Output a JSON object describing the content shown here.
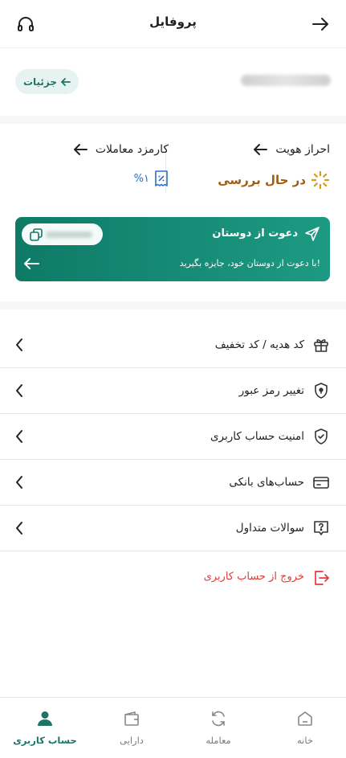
{
  "header": {
    "title": "پروفایل",
    "back_icon": "arrow-right-icon",
    "support_icon": "headphones-icon"
  },
  "account": {
    "details_label": "جزئیات",
    "details_icon": "arrow-left-icon"
  },
  "kyc": {
    "title": "احراز هویت",
    "status": "در حال بررسی",
    "status_color": "#a05d10"
  },
  "fees": {
    "title": "کارمزد معاملات",
    "value": "%۱"
  },
  "invite": {
    "title": "دعوت از دوستان",
    "subtitle": "با دعوت از دوستان خود، جایزه بگیرید!",
    "gradient_from": "#0e7a66",
    "gradient_to": "#1d9a83"
  },
  "menu": [
    {
      "label": "کد هدیه / کد تخفیف",
      "icon": "gift-icon"
    },
    {
      "label": "تغییر رمز عبور",
      "icon": "shield-lock-icon"
    },
    {
      "label": "امنیت حساب کاربری",
      "icon": "shield-check-icon"
    },
    {
      "label": "حساب‌های بانکی",
      "icon": "credit-card-icon"
    },
    {
      "label": "سوالات متداول",
      "icon": "question-icon"
    }
  ],
  "logout": {
    "label": "خروج از حساب کاربری",
    "color": "#e03b3b"
  },
  "nav": [
    {
      "label": "خانه",
      "icon": "home-icon"
    },
    {
      "label": "معامله",
      "icon": "refresh-icon"
    },
    {
      "label": "دارایی",
      "icon": "wallet-icon"
    },
    {
      "label": "حساب کاربری",
      "icon": "user-icon",
      "active": true
    }
  ],
  "colors": {
    "accent": "#1c7566",
    "danger": "#e03b3b"
  }
}
